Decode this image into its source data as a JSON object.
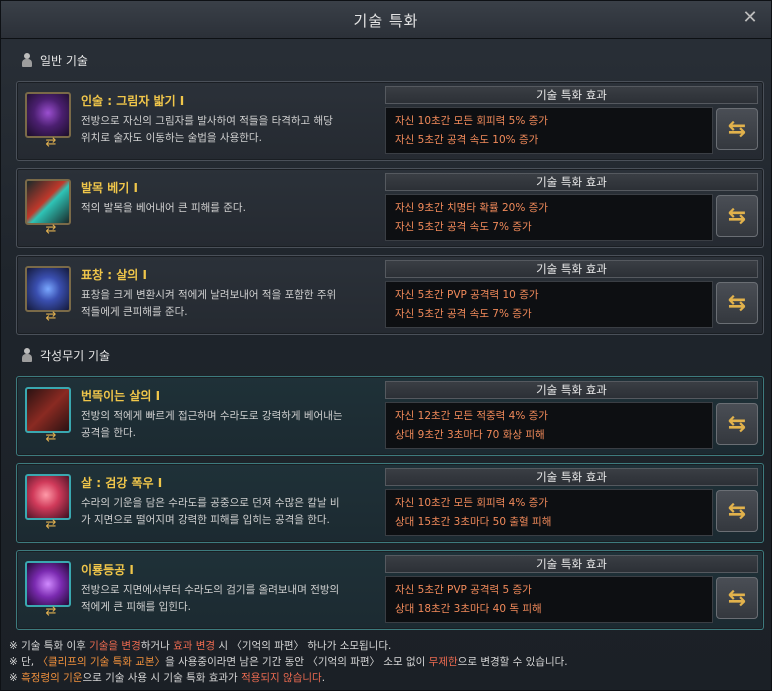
{
  "window": {
    "title": "기술 특화"
  },
  "sections": {
    "general": "일반 기술",
    "awakening": "각성무기 기술"
  },
  "effect_header": "기술 특화 효과",
  "colors": {
    "accent": "#f0c64a",
    "effect_text": "#f18a5a",
    "awakening_border": "#3d7b7e"
  },
  "skills": [
    {
      "name": "인술 : 그림자 밟기 I",
      "desc1": "전방으로 자신의 그림자를 발사하여 적들을 타격하고 해당",
      "desc2": "위치로 술자도 이동하는 술법을 사용한다.",
      "eff1": "자신 10초간 모든 회피력 5% 증가",
      "eff2": "자신 5초간 공격 속도 10% 증가"
    },
    {
      "name": "발목 베기 I",
      "desc1": "적의 발목을 베어내어 큰 피해를 준다.",
      "desc2": "",
      "eff1": "자신 9초간 치명타 확률 20% 증가",
      "eff2": "자신 5초간 공격 속도 7% 증가"
    },
    {
      "name": "표창 : 살의 I",
      "desc1": "표창을 크게 변환시켜 적에게 날려보내어 적을 포함한 주위",
      "desc2": "적들에게 큰피해를 준다.",
      "eff1": "자신 5초간 PVP 공격력 10 증가",
      "eff2": "자신 5초간 공격 속도 7% 증가"
    },
    {
      "name": "번뜩이는 살의 I",
      "desc1": "전방의 적에게 빠르게 접근하며 수라도로 강력하게 베어내는",
      "desc2": "공격을 한다.",
      "eff1": "자신 12초간 모든 적중력 4% 증가",
      "eff2": "상대 9초간 3초마다 70 화상 피해"
    },
    {
      "name": "살 : 검강 폭우 I",
      "desc1": "수라의 기운을 담은 수라도를 공중으로 던져 수많은 칼날 비",
      "desc2": "가 지면으로 떨어지며 강력한 피해를 입히는 공격을 한다.",
      "eff1": "자신 10초간 모든 회피력 4% 증가",
      "eff2": "상대 15초간 3초마다 50 출혈 피해"
    },
    {
      "name": "이룡등공 I",
      "desc1": "전방으로 지면에서부터 수라도의 검기를 올려보내며 전방의",
      "desc2": "적에게 큰 피해를 입힌다.",
      "eff1": "자신 5초간 PVP 공격력 5 증가",
      "eff2": "상대 18초간 3초마다 40 독 피해"
    }
  ],
  "notes": {
    "n1": {
      "a": "※ 기술 특화 이후 ",
      "b": "기술을 변경",
      "c": "하거나 ",
      "d": "효과 변경",
      "e": " 시 〈기억의 파편〉 하나가 소모됩니다."
    },
    "n2": {
      "a": "※ 단, ",
      "b": "〈클리프의 기술 특화 교본〉",
      "c": "을 사용중이라면 남은 기간 동안 〈기억의 파편〉 소모 없이 ",
      "d": "무제한",
      "e": "으로 변경할 수 있습니다."
    },
    "n3": {
      "a": "※ ",
      "b": "흑정령의 기운",
      "c": "으로 기술 사용 시 기술 특화 효과가 ",
      "d": "적용되지 않습니다",
      "e": "."
    }
  }
}
